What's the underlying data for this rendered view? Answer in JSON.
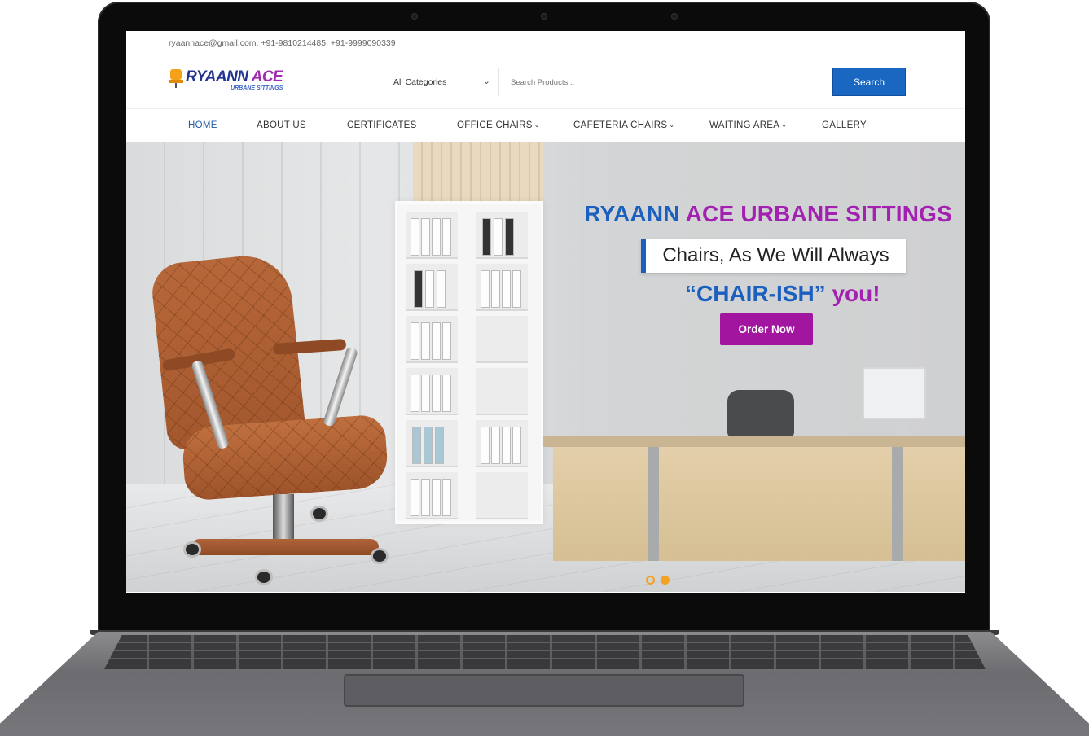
{
  "topbar": {
    "contact": "ryaannace@gmail.com, +91-9810214485, +91-9999090339"
  },
  "brand": {
    "name_part1": "RYAANN",
    "name_part2": "ACE",
    "subtitle": "URBANE SITTINGS"
  },
  "search": {
    "category_label": "All Categories",
    "placeholder": "Search Products...",
    "button_label": "Search"
  },
  "nav": {
    "home": "HOME",
    "about": "ABOUT US",
    "certificates": "CERTIFICATES",
    "office_chairs": "OFFICE CHAIRS",
    "cafeteria_chairs": "CAFETERIA CHAIRS",
    "waiting_area": "WAITING AREA",
    "gallery": "GALLERY"
  },
  "hero": {
    "title_part1": "RYAANN",
    "title_part2": "ACE URBANE SITTINGS",
    "tagline": "Chairs, As We Will Always",
    "chairish_part1": "“CHAIR-ISH”",
    "chairish_part2": "you!",
    "cta": "Order Now"
  },
  "carousel": {
    "slides": 2,
    "active_index": 2
  },
  "colors": {
    "primary_blue": "#1b5fbf",
    "brand_purple": "#a321b1",
    "cta_purple": "#a2159e",
    "search_button": "#1a67c2",
    "carousel_dot": "#f4a020"
  },
  "icons": {
    "logo": "chair-logo-icon",
    "dropdown": "chevron-down-icon"
  }
}
